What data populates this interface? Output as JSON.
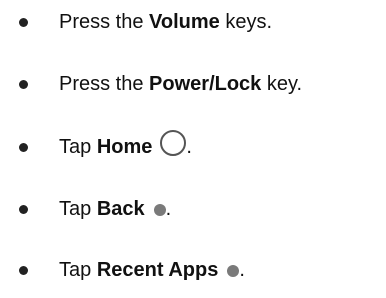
{
  "items": [
    {
      "before": "Press the ",
      "bold": "Volume",
      "after": " keys."
    },
    {
      "before": "Press the ",
      "bold": "Power/Lock",
      "after": " key."
    },
    {
      "before": "Tap ",
      "bold": "Home",
      "after": ".",
      "icon": "home-circle-icon"
    },
    {
      "before": "Tap ",
      "bold": "Back",
      "after": ".",
      "icon": "back-dot-icon"
    },
    {
      "before": "Tap ",
      "bold": "Recent Apps",
      "after": ".",
      "icon": "recent-apps-dot-icon"
    }
  ]
}
